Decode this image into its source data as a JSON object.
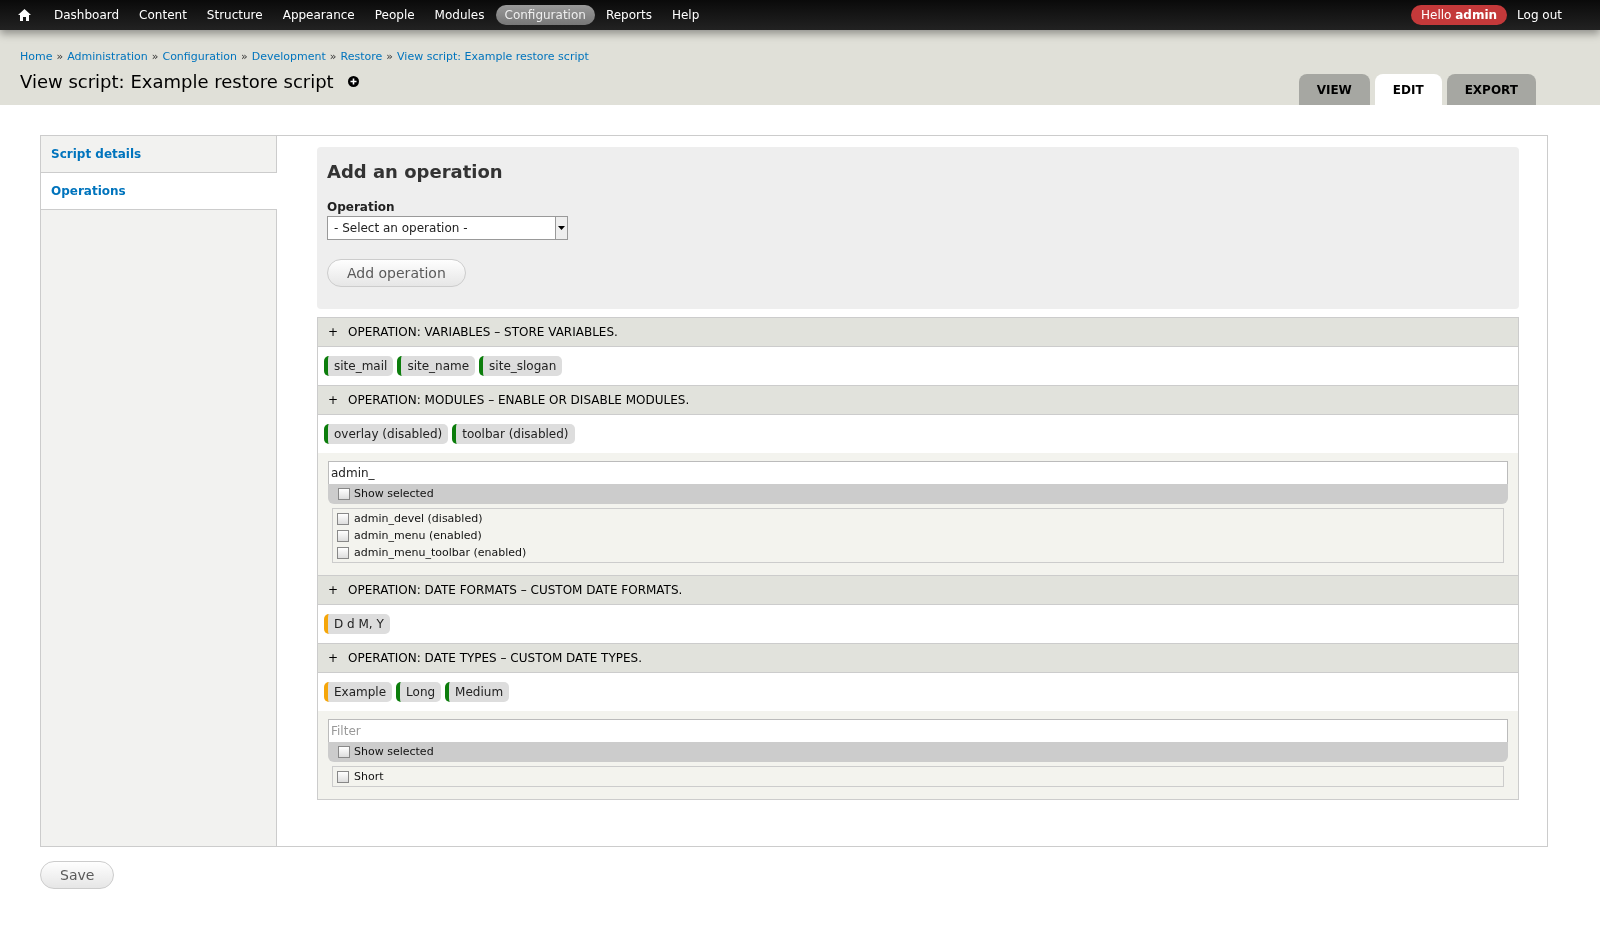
{
  "toolbar": {
    "items": [
      {
        "label": "Dashboard",
        "selected": false
      },
      {
        "label": "Content",
        "selected": false
      },
      {
        "label": "Structure",
        "selected": false
      },
      {
        "label": "Appearance",
        "selected": false
      },
      {
        "label": "People",
        "selected": false
      },
      {
        "label": "Modules",
        "selected": false
      },
      {
        "label": "Configuration",
        "selected": true
      },
      {
        "label": "Reports",
        "selected": false
      },
      {
        "label": "Help",
        "selected": false
      }
    ],
    "greeting": "Hello **admin**",
    "logout": "Log out"
  },
  "breadcrumb_separator": "»",
  "breadcrumb": [
    "Home",
    "Administration",
    "Configuration",
    "Development",
    "Restore",
    "View script: Example restore script"
  ],
  "title": "View script: Example restore script",
  "tabs": [
    {
      "label": "VIEW",
      "selected": false
    },
    {
      "label": "EDIT",
      "selected": true
    },
    {
      "label": "EXPORT",
      "selected": false
    }
  ],
  "sidebar": {
    "items": [
      {
        "label": "Script details",
        "selected": false
      },
      {
        "label": "Operations",
        "selected": true
      }
    ]
  },
  "add_operation": {
    "heading": "Add an operation",
    "label": "Operation",
    "select_value": "- Select an operation -",
    "button": "Add operation"
  },
  "operations": [
    {
      "expander": "+",
      "header": "OPERATION: VARIABLES – STORE VARIABLES.",
      "tags": [
        {
          "label": "site_mail",
          "color": "#0c7d0c"
        },
        {
          "label": "site_name",
          "color": "#0c7d0c"
        },
        {
          "label": "site_slogan",
          "color": "#0c7d0c"
        }
      ]
    },
    {
      "expander": "+",
      "header": "OPERATION: MODULES – ENABLE OR DISABLE MODULES.",
      "tags": [
        {
          "label": "overlay (disabled)",
          "color": "#0c7d0c"
        },
        {
          "label": "toolbar (disabled)",
          "color": "#0c7d0c"
        }
      ],
      "filter": {
        "value": "admin_",
        "show_selected": {
          "label": "Show selected",
          "checked": false
        },
        "options": [
          {
            "label": "admin_devel (disabled)",
            "checked": false
          },
          {
            "label": "admin_menu (enabled)",
            "checked": false
          },
          {
            "label": "admin_menu_toolbar (enabled)",
            "checked": false
          }
        ]
      }
    },
    {
      "expander": "+",
      "header": "OPERATION: DATE FORMATS – CUSTOM DATE FORMATS.",
      "tags": [
        {
          "label": "D d M, Y",
          "color": "#f5a60a"
        }
      ]
    },
    {
      "expander": "+",
      "header": "OPERATION: DATE TYPES – CUSTOM DATE TYPES.",
      "tags": [
        {
          "label": "Example",
          "color": "#f5a60a"
        },
        {
          "label": "Long",
          "color": "#0c7d0c"
        },
        {
          "label": "Medium",
          "color": "#0c7d0c"
        }
      ],
      "filter": {
        "placeholder": "Filter",
        "show_selected": {
          "label": "Show selected",
          "checked": false
        },
        "options": [
          {
            "label": "Short",
            "checked": false
          }
        ]
      }
    }
  ],
  "save": "Save"
}
